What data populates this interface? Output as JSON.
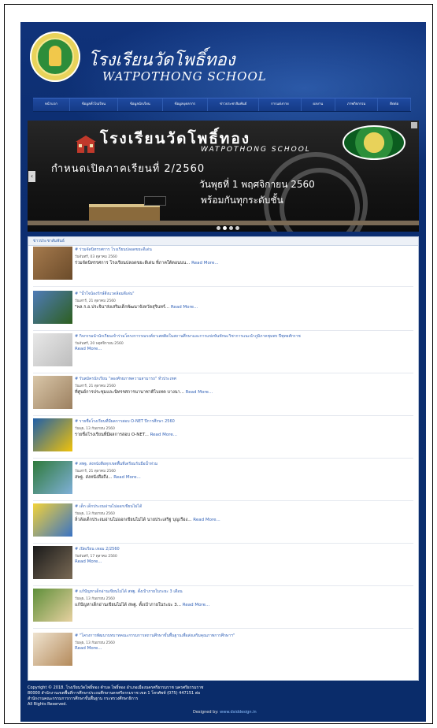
{
  "site": {
    "title_th": "โรงเรียนวัดโพธิ์ทอง",
    "title_en": "WATPOTHONG SCHOOL"
  },
  "nav": [
    "หน้าแรก",
    "ข้อมูลทั่วไปเรียน",
    "ข้อมูลนักเรียน",
    "ข้อมูลบุคลากร",
    "ข่าวประชาสัมพันธ์",
    "การแต่งกาย",
    "ผลงาน",
    "ภาพกิจกรรม",
    "ติดต่อ"
  ],
  "slider": {
    "title": "โรงเรียนวัดโพธิ์ทอง",
    "subtitle": "WATPOTHONG SCHOOL",
    "line1": "กำหนดเปิดภาคเรียนที่ 2/2560",
    "line2": "วันพุธที่ 1 พฤศจิกายน 2560",
    "line3": "พร้อมกันทุกระดับชั้น",
    "prev_label": "‹",
    "dot_count": 4,
    "active_dot": 1
  },
  "news": {
    "heading": "ข่าวประชาสัมพันธ์",
    "read_more": "Read More...",
    "items": [
      {
        "title": "# ร่วมจัดนิทรรศการ โรงเรียนปลอดขยะดีเด่น",
        "date": "วันจันทร์, 03 ตุลาคม 2560",
        "body": "ร่วมจัดนิทรรศการ โรงเรียนปลอดขยะดีเด่น ที่ภาคใต้ตอนบน..."
      },
      {
        "title": "# \"น้ำใจน้องรักษ์สิ่งแวดล้อมดีเด่น\"",
        "date": "วันเสาร์, 21 ตุลาคม 2560",
        "body": "\"พล.ร.อ.ประจิน\"ส่งเสริมเด็กพัฒนาจังหวัดสุรินทร์..."
      },
      {
        "title": "# กิจกรรมนำนักเรียนเข้าร่วมโครงการรณรงค์ยาเสพติดในสถานศึกษาและการแข่งขันทักษะวิชาการแนะนำภูมิภาคชุมพร ปีพุทธศักราช",
        "date": "วันจันทร์, 20 พฤศจิกายน 2560",
        "body": ""
      },
      {
        "title": "# รับสมัครนักเรียน \"ลองศักยภาพความสามารถ\" ทั่วประเทศ",
        "date": "วันเสาร์, 21 ตุลาคม 2560",
        "body": "ที่ศูนย์การประชุมและนิทรรศการนานาชาติไบเทค บางนา..."
      },
      {
        "title": "# รายชื่อโรงเรียนที่มีผลการสอบ O-NET ปีการศึกษา 2560",
        "date": "วันพุธ, 13 กันยายน 2560",
        "body": "รายชื่อโรงเรียนที่มีผลการสอบ O-NET..."
      },
      {
        "title": "# สพฐ. ส่งหนังสือทุกเขตพื้นที่เตรียมรับมือน้ำท่วม",
        "date": "วันเสาร์, 21 ตุลาคม 2560",
        "body": "สพฐ. ส่งหนังสือถึง..."
      },
      {
        "title": "# เด็ก เด็กประถมอ่านไม่ออกเขียนไม่ได้",
        "date": "วันพุธ, 13 กันยายน 2560",
        "body": "ลิ่วล้อเด็กประถมอ่านไม่ออกเขียนไม่ได้ นายประเสริฐ บุญเรือง..."
      },
      {
        "title": "# เปิดเรียน เทอม 2/2560",
        "date": "วันจันทร์, 17 ตุลาคม 2560",
        "body": ""
      },
      {
        "title": "# แก้ปัญหาเด็กอ่านเขียนไม่ได้ สพฐ. ตั้งเป้าภายในระยะ 3 เดือน",
        "date": "วันพุธ, 13 กันยายน 2560",
        "body": "แก้ปัญหาเด็กอ่านเขียนไม่ได้ สพฐ. ตั้งเป้าภายในระยะ 3..."
      },
      {
        "title": "# \"โครงการพัฒนาบทบาทคณะกรรมการสถานศึกษาขั้นพื้นฐานเพื่อส่งเสริมคุณภาพการศึกษาฯ\"",
        "date": "วันพุธ, 13 กันยายน 2560",
        "body": ""
      }
    ]
  },
  "footer": {
    "line1": "Copyright © 2018. โรงเรียนวัดโพธิ์ทอง ตำบล โพธิ์ทอง อำเภอเมืองนครศรีธรรมราช นครศรีธรรมราช",
    "line2": "80000 สำนักงานเขตพื้นที่การศึกษาประถมศึกษานครศรีธรรมราช เขต 1 โทรศัพท์ (075) 447151 ต่อ",
    "line3": "สำนักงานคณะกรรมการการศึกษาขั้นพื้นฐาน กระทรวงศึกษาธิการ",
    "line4": "All Rights Reserved.",
    "designed_label": "Designed by:",
    "designed_link": "www.dsiddesign.in"
  },
  "colors": {
    "page_bg": "#0d2f73",
    "nav_bg": "#1a449b",
    "link": "#3564b8"
  }
}
